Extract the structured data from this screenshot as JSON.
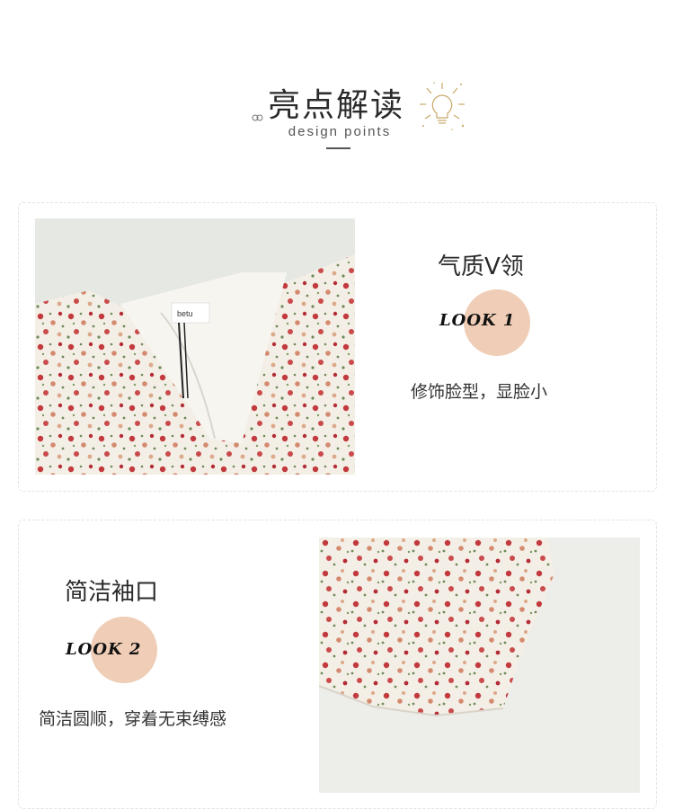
{
  "header": {
    "title": "亮点解读",
    "subtitle": "design points"
  },
  "features": [
    {
      "title": "气质V领",
      "look": "LOOK 1",
      "description": "修饰脸型，显脸小",
      "photo_label": "betu"
    },
    {
      "title": "简洁袖口",
      "look": "LOOK 2",
      "description": "简洁圆顺，穿着无束缚感"
    }
  ],
  "colors": {
    "look_circle": "#efcdb6",
    "card_border": "#e3e3e3",
    "title_text": "#2b2b2b"
  }
}
